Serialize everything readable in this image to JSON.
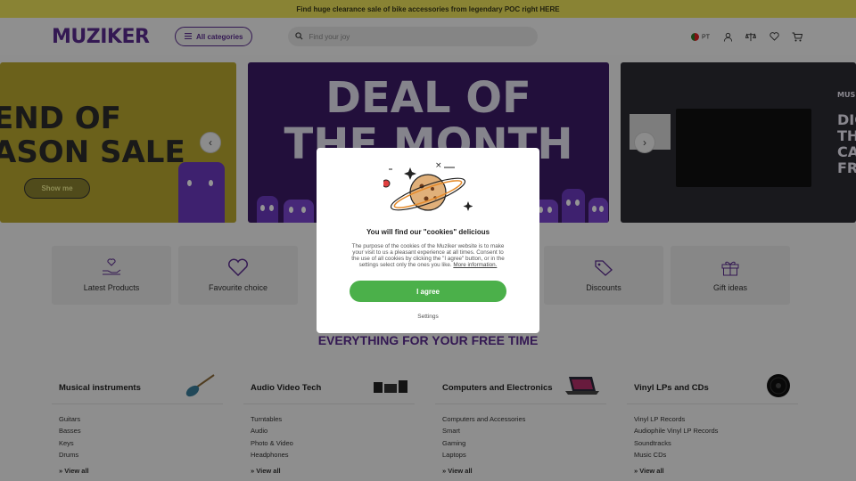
{
  "promo_bar": {
    "text": "Find huge clearance sale of bike accessories from legendary POC right HERE"
  },
  "header": {
    "logo": "MUZIKER",
    "all_categories_label": "All categories",
    "search": {
      "placeholder": "Find your joy",
      "value": ""
    },
    "language": "PT",
    "icons": [
      "user-icon",
      "compare-icon",
      "heart-icon",
      "cart-icon"
    ]
  },
  "carousel": {
    "banner_left": {
      "headline_line1": "END OF",
      "headline_line2": "ASON SALE",
      "button_label": "Show me"
    },
    "banner_center": {
      "headline_line1": "DEAL OF",
      "headline_line2": "THE MONTH"
    },
    "banner_right": {
      "brand": "MUSI",
      "headline_lines": [
        "DIG",
        "THE",
        "CA",
        "FRO"
      ]
    }
  },
  "tiles": [
    {
      "label": "Latest Products",
      "icon": "hand-heart-icon"
    },
    {
      "label": "Favourite choice",
      "icon": "heart-outline-icon"
    },
    {
      "label": "Discounts",
      "icon": "tag-icon"
    },
    {
      "label": "Gift ideas",
      "icon": "gift-icon"
    }
  ],
  "section_title": "EVERYTHING FOR YOUR FREE TIME",
  "categories": [
    {
      "title": "Musical instruments",
      "items": [
        "Guitars",
        "Basses",
        "Keys",
        "Drums"
      ],
      "view_all": "View all",
      "image": "guitar"
    },
    {
      "title": "Audio Video Tech",
      "items": [
        "Turntables",
        "Audio",
        "Photo & Video",
        "Headphones"
      ],
      "view_all": "View all",
      "image": "audio-system"
    },
    {
      "title": "Computers and Electronics",
      "items": [
        "Computers and Accessories",
        "Smart",
        "Gaming",
        "Laptops"
      ],
      "view_all": "View all",
      "image": "laptop"
    },
    {
      "title": "Vinyl LPs and CDs",
      "items": [
        "Vinyl LP Records",
        "Audiophile Vinyl LP Records",
        "Soundtracks",
        "Music CDs"
      ],
      "view_all": "View all",
      "image": "vinyl"
    }
  ],
  "cookie_modal": {
    "title": "You will find our \"cookies\" delicious",
    "body": "The purpose of the cookies of the Muziker website is to make your visit to us a pleasant experience at all times. Consent to the use of all cookies by clicking the \"I agree\" button, or in the settings select only the ones you like.",
    "more_link": "More information.",
    "agree_label": "I agree",
    "settings_label": "Settings"
  },
  "colors": {
    "brand_purple": "#5b2c8f",
    "promo_yellow": "#ece25a",
    "agree_green": "#4bb04a"
  }
}
